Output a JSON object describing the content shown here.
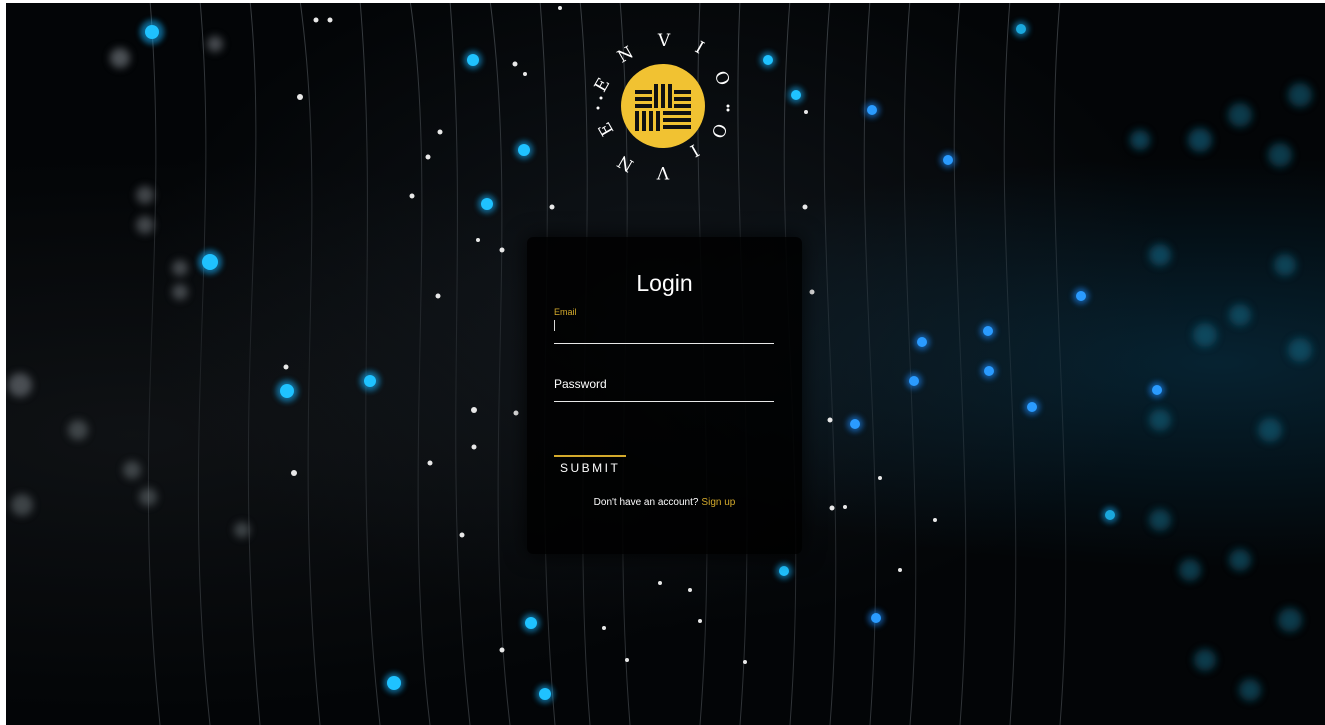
{
  "brand": {
    "ring_letters": [
      "E",
      "N",
      "V",
      "I",
      "O",
      "O",
      "I",
      "V",
      "N",
      "E"
    ],
    "emblem_color": "#f1c232",
    "emblem_icon": "envio-logo-emblem"
  },
  "login": {
    "title": "Login",
    "email": {
      "label": "Email",
      "value": ""
    },
    "password": {
      "label": "Password",
      "value": ""
    },
    "submit_label": "SUBMIT",
    "signup_prompt": "Don't have an account?",
    "signup_link": "Sign up"
  },
  "colors": {
    "accent": "#d4aa2c",
    "card_background": "#000000",
    "text": "#ffffff",
    "particle_blue": "#12b4ff",
    "particle_white": "#e8e8e8"
  }
}
